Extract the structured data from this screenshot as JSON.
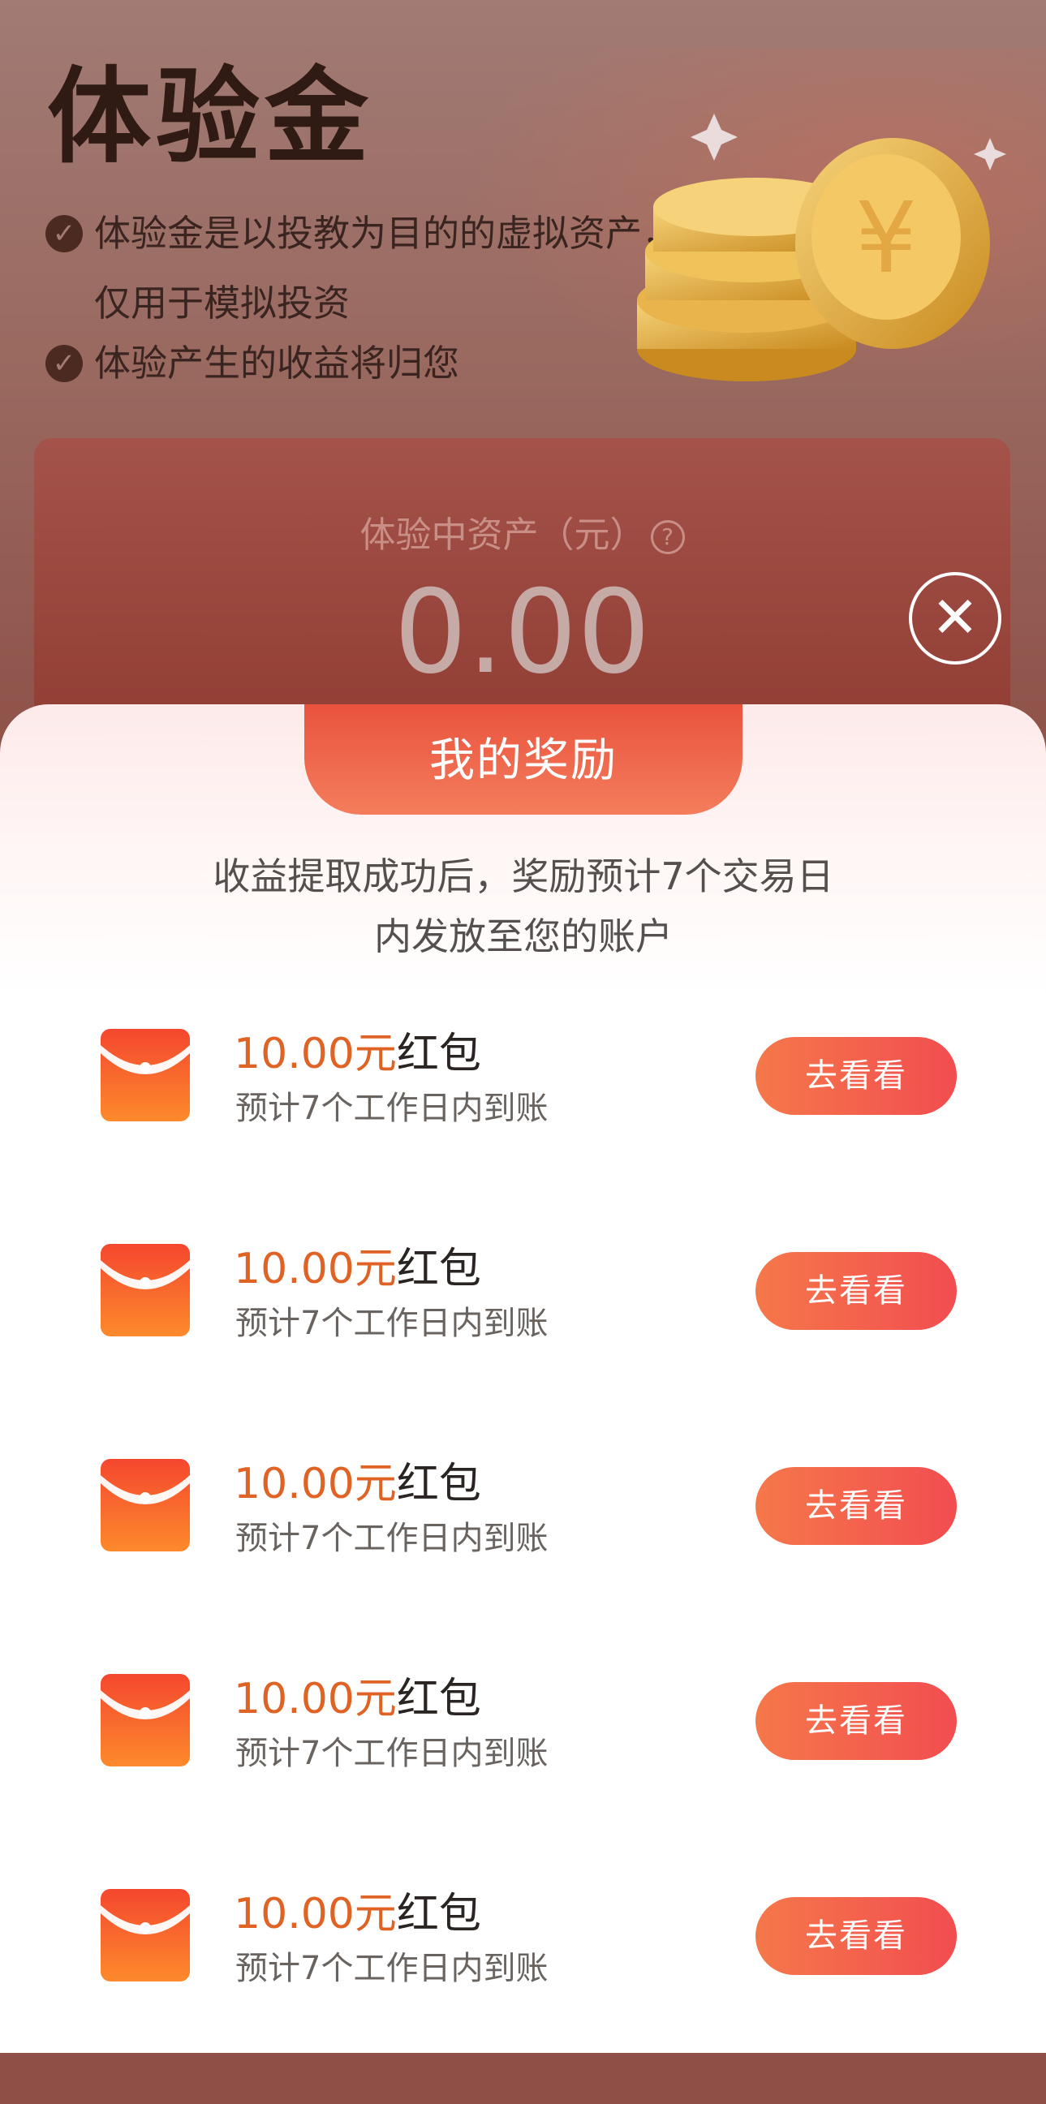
{
  "background": {
    "title": "体验金",
    "bullets": [
      "体验金是以投教为目的的虚拟资产，仅用于模拟投资",
      "体验产生的收益将归您"
    ],
    "asset_label": "体验中资产（元）",
    "asset_help_icon": "?",
    "asset_value": "0.00"
  },
  "close_icon": "✕",
  "sheet": {
    "tab_title": "我的奖励",
    "description": "收益提取成功后，奖励预计7个交易日内发放至您的账户",
    "rewards": [
      {
        "amount": "10.00元",
        "suffix": "红包",
        "subtitle": "预计7个工作日内到账",
        "button": "去看看"
      },
      {
        "amount": "10.00元",
        "suffix": "红包",
        "subtitle": "预计7个工作日内到账",
        "button": "去看看"
      },
      {
        "amount": "10.00元",
        "suffix": "红包",
        "subtitle": "预计7个工作日内到账",
        "button": "去看看"
      },
      {
        "amount": "10.00元",
        "suffix": "红包",
        "subtitle": "预计7个工作日内到账",
        "button": "去看看"
      },
      {
        "amount": "10.00元",
        "suffix": "红包",
        "subtitle": "预计7个工作日内到账",
        "button": "去看看"
      }
    ]
  },
  "colors": {
    "accent_orange": "#e06326",
    "button_start": "#f5784a",
    "button_end": "#f24d50",
    "tab_red": "#e9533e"
  }
}
